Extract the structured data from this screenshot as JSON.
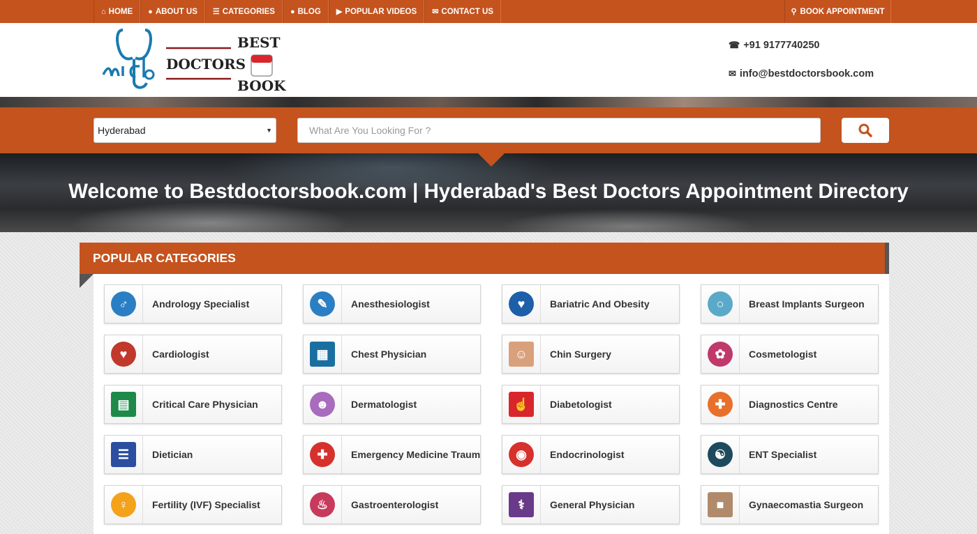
{
  "nav": {
    "items": [
      {
        "label": "HOME",
        "icon": "home-icon",
        "glyph": "⌂"
      },
      {
        "label": "ABOUT US",
        "icon": "user-icon",
        "glyph": "👤"
      },
      {
        "label": "CATEGORIES",
        "icon": "list-icon",
        "glyph": "☰"
      },
      {
        "label": "BLOG",
        "icon": "circle-icon",
        "glyph": "●"
      },
      {
        "label": "POPULAR VIDEOS",
        "icon": "video-icon",
        "glyph": "▶"
      },
      {
        "label": "CONTACT US",
        "icon": "envelope-icon",
        "glyph": "✉"
      }
    ],
    "book_appointment": "BOOK APPOINTMENT"
  },
  "logo": {
    "line1": "BEST",
    "line2": "DOCTORS",
    "line3": "BOOK"
  },
  "contact": {
    "phone": "+91 9177740250",
    "email": "info@bestdoctorsbook.com"
  },
  "search": {
    "city": "Hyderabad",
    "placeholder": "What Are You Looking For ?"
  },
  "hero": {
    "title": "Welcome to Bestdoctorsbook.com | Hyderabad's Best Doctors Appointment Directory"
  },
  "categories": {
    "heading": "POPULAR CATEGORIES",
    "items": [
      {
        "label": "Andrology Specialist",
        "icon": "andrology-icon",
        "color": "#2a7fc4"
      },
      {
        "label": "Anesthesiologist",
        "icon": "anesthesia-icon",
        "color": "#2a7fc4"
      },
      {
        "label": "Bariatric And Obesity",
        "icon": "stomach-icon",
        "color": "#1d5fa8"
      },
      {
        "label": "Breast Implants Surgeon",
        "icon": "breast-icon",
        "color": "#5aa9c9"
      },
      {
        "label": "Cardiologist",
        "icon": "heart-icon",
        "color": "#c0392b"
      },
      {
        "label": "Chest Physician",
        "icon": "chest-icon",
        "color": "#1a6fa0"
      },
      {
        "label": "Chin Surgery",
        "icon": "chin-icon",
        "color": "#d9a07c"
      },
      {
        "label": "Cosmetologist",
        "icon": "face-icon",
        "color": "#c0396b"
      },
      {
        "label": "Critical Care Physician",
        "icon": "bed-icon",
        "color": "#1e8a4a"
      },
      {
        "label": "Dermatologist",
        "icon": "skin-icon",
        "color": "#a86bbd"
      },
      {
        "label": "Diabetologist",
        "icon": "diabetes-icon",
        "color": "#d9262c"
      },
      {
        "label": "Diagnostics Centre",
        "icon": "diagnostics-icon",
        "color": "#e8702a"
      },
      {
        "label": "Dietician",
        "icon": "clipboard-icon",
        "color": "#2c4ea0"
      },
      {
        "label": "Emergency Medicine Traum",
        "icon": "cross-icon",
        "color": "#d6312c"
      },
      {
        "label": "Endocrinologist",
        "icon": "drop-icon",
        "color": "#d6312c"
      },
      {
        "label": "ENT Specialist",
        "icon": "ent-icon",
        "color": "#1e4a5e"
      },
      {
        "label": "Fertility (IVF) Specialist",
        "icon": "fertility-icon",
        "color": "#f3a21a"
      },
      {
        "label": "Gastroenterologist",
        "icon": "gastro-icon",
        "color": "#c83a5c"
      },
      {
        "label": "General Physician",
        "icon": "doctor-icon",
        "color": "#6a3a8a"
      },
      {
        "label": "Gynaecomastia Surgeon",
        "icon": "torso-icon",
        "color": "#b08a6a"
      }
    ]
  }
}
